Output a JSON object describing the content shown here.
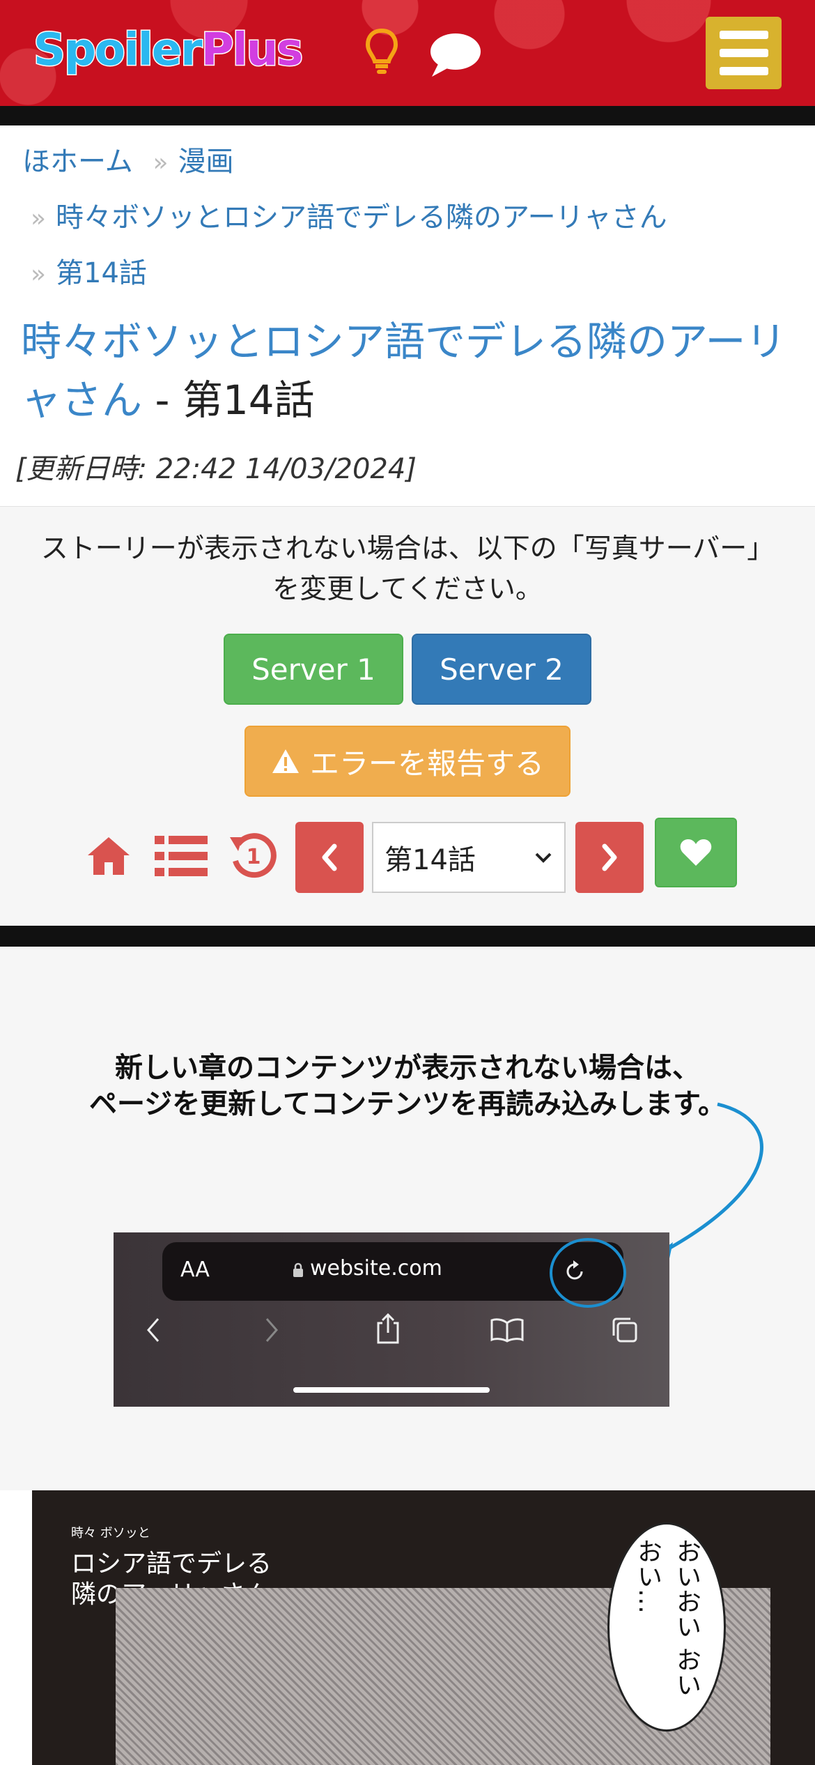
{
  "header": {
    "logo_part1": "Spoiler",
    "logo_part2": "Plus"
  },
  "breadcrumb": {
    "home": "ほホーム",
    "category": "漫画",
    "series": "時々ボソッとロシア語でデレる隣のアーリャさん",
    "chapter": "第14話",
    "separator": "»"
  },
  "page": {
    "title_link": "時々ボソッとロシア語でデレる隣のアーリャさん",
    "title_suffix": " - 第14話",
    "updated": "[更新日時: 22:42 14/03/2024]"
  },
  "controls": {
    "notice": "ストーリーが表示されない場合は、以下の「写真サーバー」を変更してください。",
    "server1": "Server 1",
    "server2": "Server 2",
    "report": "エラーを報告する",
    "chapter_selected": "第14話"
  },
  "info": {
    "line1": "新しい章のコンテンツが表示されない場合は、",
    "line2": "ページを更新してコンテンツを再読み込みします。",
    "url_aa": "AA",
    "url": "website.com"
  },
  "manga": {
    "logo_small": "時々 ボソッと",
    "logo_line1": "ロシア語でデレる",
    "logo_line2": "隣のアーリャさん",
    "bubble": "おいおい おいおい…"
  },
  "colors": {
    "header_red": "#c8101f",
    "menu_gold": "#d8b22e",
    "link_blue": "#337ab7",
    "green": "#5cb85c",
    "blue": "#337ab7",
    "orange": "#f0ad4e",
    "red": "#d9534f"
  }
}
